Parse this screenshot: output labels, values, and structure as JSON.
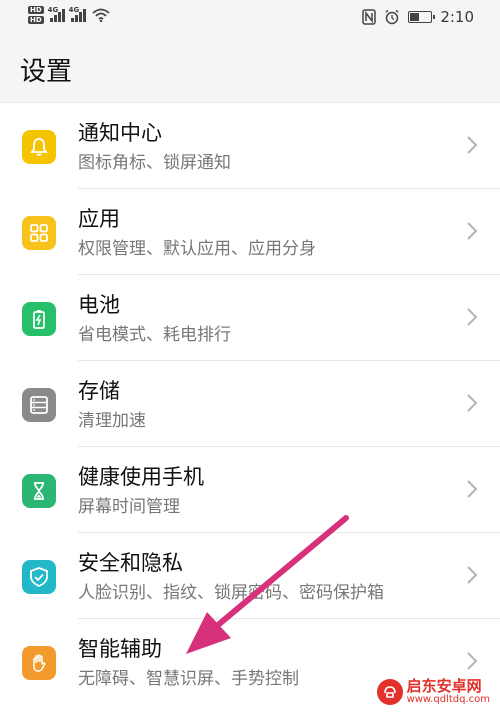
{
  "status_bar": {
    "hd1": "HD",
    "hd2": "HD",
    "net1": "4G",
    "net2": "4G",
    "nfc_icon": "nfc-icon",
    "alarm_icon": "alarm-icon",
    "time": "2:10"
  },
  "header": {
    "title": "设置"
  },
  "items": [
    {
      "name": "通知中心",
      "desc": "图标角标、锁屏通知",
      "icon": "bell-icon",
      "color": "#f5c400"
    },
    {
      "name": "应用",
      "desc": "权限管理、默认应用、应用分身",
      "icon": "apps-icon",
      "color": "#f7c21a"
    },
    {
      "name": "电池",
      "desc": "省电模式、耗电排行",
      "icon": "battery-icon",
      "color": "#27c06a"
    },
    {
      "name": "存储",
      "desc": "清理加速",
      "icon": "storage-icon",
      "color": "#8a8a8a"
    },
    {
      "name": "健康使用手机",
      "desc": "屏幕时间管理",
      "icon": "hourglass-icon",
      "color": "#2bb673"
    },
    {
      "name": "安全和隐私",
      "desc": "人脸识别、指纹、锁屏密码、密码保护箱",
      "icon": "shield-icon",
      "color": "#22b8c8"
    },
    {
      "name": "智能辅助",
      "desc": "无障碍、智慧识屏、手势控制",
      "icon": "hand-icon",
      "color": "#f39a2c"
    }
  ],
  "annotation": {
    "arrow_color": "#d6317a"
  },
  "watermark": {
    "text": "启东安卓网",
    "url": "www.qdltdq.com"
  }
}
